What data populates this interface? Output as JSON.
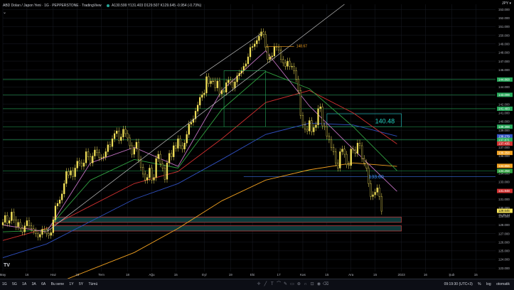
{
  "header": {
    "symbol": "ABD Doları / Japon Yeni · 1G · PEPPERSTONE · TradingView",
    "ohlc": "A130.599 Y131.403 D129.507 K129.645 -0.954 (-0.73%)",
    "collapse": "⌄"
  },
  "currency_label": "JPY ▾",
  "colors": {
    "background": "#000000",
    "candle": "#f5e35a",
    "grid": "#1a1d26",
    "line_green_level": "#26a85a",
    "line_blue_level": "#3a6fe0",
    "ma_orange": "#f0a020",
    "ma_red": "#d03030",
    "ma_blue": "#3050c0",
    "ma_green": "#30a040",
    "ma_pink": "#c070c0",
    "box_teal": "#20a0a0"
  },
  "price_axis": {
    "ticks": [
      "153.000",
      "152.000",
      "151.000",
      "150.000",
      "149.000",
      "148.000",
      "147.000",
      "146.000",
      "145.000",
      "144.000",
      "143.000",
      "142.000",
      "141.000",
      "140.000",
      "139.000",
      "138.000",
      "137.000",
      "136.000",
      "135.000",
      "134.000",
      "133.000",
      "132.000",
      "131.000",
      "130.000",
      "129.000",
      "128.000",
      "127.000",
      "126.000",
      "125.000",
      "124.000",
      "123.000"
    ],
    "tags": [
      {
        "text": "144.868",
        "price": 144.868,
        "color": "#26a85a"
      },
      {
        "text": "143.099",
        "price": 143.099,
        "color": "#26a85a"
      },
      {
        "text": "141.483",
        "price": 141.483,
        "color": "#26a85a"
      },
      {
        "text": "139.398",
        "price": 139.398,
        "color": "#26a85a"
      },
      {
        "text": "138.279",
        "price": 138.279,
        "color": "#3050c0"
      },
      {
        "text": "137.871",
        "price": 137.871,
        "color": "#26a85a"
      },
      {
        "text": "137.435",
        "price": 137.435,
        "color": "#d03030"
      },
      {
        "text": "136.358",
        "price": 136.358,
        "color": "#f0a020"
      },
      {
        "text": "134.856",
        "price": 134.856,
        "color": "#f0a020"
      },
      {
        "text": "134.258",
        "price": 134.258,
        "color": "#30a040"
      },
      {
        "text": "131.948",
        "price": 131.948,
        "color": "#d03030"
      },
      {
        "text": "129.645",
        "price": 129.645,
        "color": "#f5e35a"
      }
    ],
    "countdown": "15:39:24"
  },
  "time_axis": {
    "labels": [
      {
        "text": "May",
        "i": 0
      },
      {
        "text": "16",
        "i": 11
      },
      {
        "text": "Haz",
        "i": 23
      },
      {
        "text": "15",
        "i": 34
      },
      {
        "text": "Tem",
        "i": 45
      },
      {
        "text": "18",
        "i": 57
      },
      {
        "text": "Ağu",
        "i": 68
      },
      {
        "text": "15",
        "i": 79
      },
      {
        "text": "Eyl",
        "i": 92
      },
      {
        "text": "19",
        "i": 104
      },
      {
        "text": "Eki",
        "i": 114
      },
      {
        "text": "17",
        "i": 126
      },
      {
        "text": "Kas",
        "i": 137
      },
      {
        "text": "15",
        "i": 148
      },
      {
        "text": "Ara",
        "i": 159
      },
      {
        "text": "15",
        "i": 170
      },
      {
        "text": "2023",
        "i": 182
      },
      {
        "text": "16",
        "i": 193
      },
      {
        "text": "Şub",
        "i": 205
      },
      {
        "text": "15",
        "i": 216
      }
    ]
  },
  "annotations": {
    "top_label": "148.67",
    "box_label": "140.48",
    "blue_label": "133.60"
  },
  "chart_data": {
    "type": "candlestick",
    "title": "ABD Doları / Japon Yeni · 1G · PEPPERSTONE · TradingView",
    "ylim": [
      122.6,
      153.6
    ],
    "x_range": [
      0,
      225
    ],
    "n_candles": 170,
    "closes": [
      128.3,
      129.1,
      128.2,
      128.5,
      129.5,
      128.6,
      127.8,
      128.3,
      127.6,
      127.2,
      127.9,
      128.5,
      127.9,
      127.6,
      127.3,
      127.0,
      126.6,
      126.9,
      127.5,
      127.4,
      127.0,
      126.8,
      127.1,
      128.6,
      130.2,
      130.5,
      130.9,
      131.6,
      132.8,
      134.2,
      133.8,
      134.3,
      133.6,
      134.6,
      135.4,
      135.2,
      134.8,
      135.2,
      136.5,
      135.9,
      135.2,
      136.0,
      136.7,
      136.4,
      135.8,
      135.8,
      135.9,
      136.5,
      137.3,
      137.1,
      138.0,
      138.6,
      138.9,
      137.8,
      138.2,
      139.1,
      138.6,
      138.1,
      137.2,
      136.2,
      136.9,
      137.6,
      135.6,
      134.7,
      133.9,
      133.2,
      133.5,
      134.6,
      133.2,
      133.5,
      135.7,
      136.2,
      135.1,
      134.6,
      133.3,
      135.2,
      136.3,
      135.9,
      137.2,
      136.9,
      138.0,
      137.2,
      136.8,
      137.5,
      138.5,
      139.7,
      139.9,
      140.3,
      141.2,
      141.9,
      142.8,
      143.1,
      143.3,
      145.2,
      144.4,
      144.7,
      144.7,
      143.9,
      144.7,
      143.2,
      143.6,
      143.4,
      144.5,
      144.8,
      144.6,
      143.9,
      144.6,
      145.3,
      145.6,
      145.9,
      146.4,
      146.7,
      147.5,
      148.6,
      148.7,
      149.0,
      149.4,
      149.9,
      150.4,
      150.1,
      148.6,
      147.2,
      147.5,
      147.6,
      148.7,
      148.6,
      148.3,
      147.2,
      146.8,
      146.4,
      147.0,
      146.4,
      146.4,
      145.9,
      144.9,
      143.6,
      140.7,
      139.6,
      139.1,
      138.9,
      140.1,
      138.8,
      139.3,
      139.6,
      141.5,
      141.7,
      139.5,
      139.4,
      138.3,
      137.9,
      137.0,
      136.5,
      135.2,
      134.6,
      136.5,
      136.8,
      136.2,
      135.0,
      134.9,
      136.8,
      136.7,
      136.3,
      137.5,
      137.2,
      135.7,
      135.2,
      134.6,
      132.8,
      131.3,
      131.5,
      131.8,
      132.3,
      131.3,
      129.6
    ],
    "moving_averages": [
      {
        "color": "#f0a020",
        "points": [
          [
            0,
            119.6
          ],
          [
            20,
            120.8
          ],
          [
            40,
            122.8
          ],
          [
            60,
            124.8
          ],
          [
            80,
            127.6
          ],
          [
            100,
            130.8
          ],
          [
            120,
            133.2
          ],
          [
            140,
            134.4
          ],
          [
            160,
            135.2
          ],
          [
            180,
            134.8
          ]
        ]
      },
      {
        "color": "#3050c0",
        "points": [
          [
            0,
            124.2
          ],
          [
            20,
            125.8
          ],
          [
            40,
            128.4
          ],
          [
            60,
            131.0
          ],
          [
            80,
            132.8
          ],
          [
            100,
            135.6
          ],
          [
            120,
            138.5
          ],
          [
            140,
            139.8
          ],
          [
            160,
            139.6
          ],
          [
            180,
            138.3
          ]
        ]
      },
      {
        "color": "#d03030",
        "points": [
          [
            0,
            126.2
          ],
          [
            20,
            127.6
          ],
          [
            40,
            130.2
          ],
          [
            60,
            132.8
          ],
          [
            80,
            134.2
          ],
          [
            100,
            138.0
          ],
          [
            120,
            142.2
          ],
          [
            140,
            143.6
          ],
          [
            160,
            141.0
          ],
          [
            180,
            137.4
          ]
        ]
      },
      {
        "color": "#30a040",
        "points": [
          [
            0,
            127.2
          ],
          [
            20,
            127.4
          ],
          [
            40,
            133.2
          ],
          [
            60,
            135.6
          ],
          [
            80,
            134.6
          ],
          [
            100,
            141.4
          ],
          [
            120,
            145.8
          ],
          [
            140,
            143.8
          ],
          [
            160,
            139.4
          ],
          [
            180,
            134.3
          ]
        ]
      },
      {
        "color": "#c070c0",
        "points": [
          [
            0,
            128.0
          ],
          [
            20,
            127.2
          ],
          [
            40,
            135.2
          ],
          [
            60,
            137.0
          ],
          [
            80,
            134.8
          ],
          [
            100,
            143.6
          ],
          [
            120,
            148.2
          ],
          [
            140,
            141.8
          ],
          [
            160,
            136.8
          ],
          [
            180,
            131.9
          ]
        ]
      }
    ],
    "horizontal_levels": [
      {
        "price": 144.868,
        "color": "#26a85a",
        "start": 0
      },
      {
        "price": 143.099,
        "color": "#26a85a",
        "start": 0
      },
      {
        "price": 141.483,
        "color": "#26a85a",
        "start": 0
      },
      {
        "price": 139.398,
        "color": "#26a85a",
        "start": 0
      },
      {
        "price": 137.871,
        "color": "#26a85a",
        "start": 0
      },
      {
        "price": 134.256,
        "color": "#26a85a",
        "start": 0
      },
      {
        "price": 133.6,
        "color": "#3a6fe0",
        "start": 110
      }
    ]
  }
}
